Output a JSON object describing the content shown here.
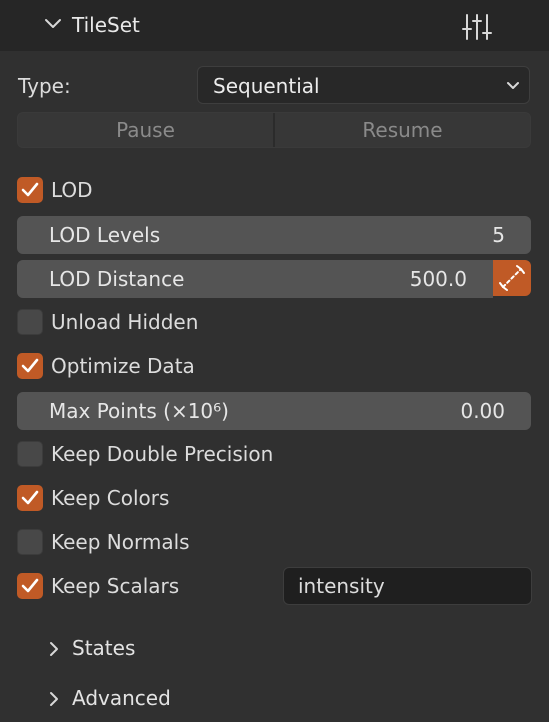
{
  "panel": {
    "title": "TileSet"
  },
  "type_row": {
    "label": "Type:",
    "value": "Sequential"
  },
  "buttons": {
    "pause": "Pause",
    "resume": "Resume"
  },
  "lod": {
    "label": "LOD",
    "checked": true
  },
  "lod_levels": {
    "label": "LOD Levels",
    "value": "5"
  },
  "lod_distance": {
    "label": "LOD Distance",
    "value": "500.0"
  },
  "unload_hidden": {
    "label": "Unload Hidden",
    "checked": false
  },
  "optimize_data": {
    "label": "Optimize Data",
    "checked": true
  },
  "max_points": {
    "label": "Max Points (×10⁶)",
    "value": "0.00"
  },
  "keep_double_precision": {
    "label": "Keep Double Precision",
    "checked": false
  },
  "keep_colors": {
    "label": "Keep Colors",
    "checked": true
  },
  "keep_normals": {
    "label": "Keep Normals",
    "checked": false
  },
  "keep_scalars": {
    "label": "Keep Scalars",
    "checked": true,
    "field_value": "intensity"
  },
  "subpanels": [
    {
      "label": "States"
    },
    {
      "label": "Advanced"
    }
  ],
  "colors": {
    "accent": "#c05a26",
    "background": "#303030",
    "header": "#262626",
    "field": "#545454"
  }
}
